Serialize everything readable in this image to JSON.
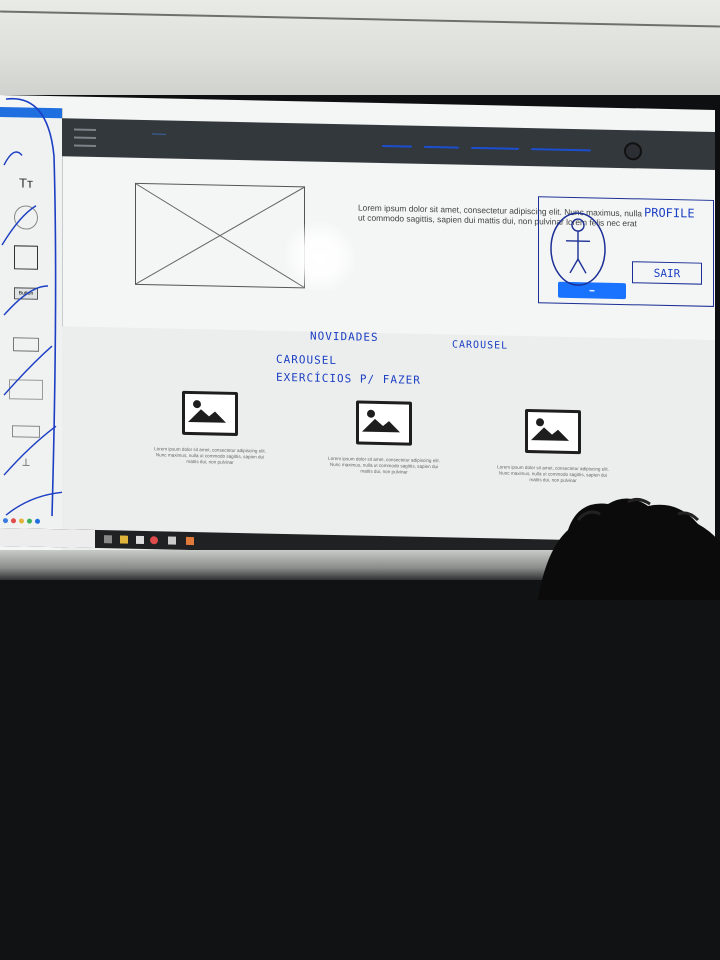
{
  "hero": {
    "paragraph": "Lorem ipsum dolor sit amet, consectetur adipiscing elit. Nunc maximus, nulla ut commodo sagittis, sapien dui mattis dui, non pulvinar lorem felis nec erat"
  },
  "annotations": {
    "novidades": "NOVIDADES",
    "carousel_right": "CAROUSEL",
    "carousel_left": "CAROUSEL",
    "exercicios": "EXERCÍCIOS P/ FAZER"
  },
  "profile": {
    "label": "PROFILE",
    "logout_label": "SAIR"
  },
  "cards": [
    {
      "text": "Lorem ipsum dolor sit amet, consectetur adipiscing elit. Nunc maximus, nulla ut commodo sagittis, sapien dui mattis dui, non pulvinar"
    },
    {
      "text": "Lorem ipsum dolor sit amet, consectetur adipiscing elit. Nunc maximus, nulla ut commodo sagittis, sapien dui mattis dui, non pulvinar"
    },
    {
      "text": "Lorem ipsum dolor sit amet, consectetur adipiscing elit. Nunc maximus, nulla ut commodo sagittis, sapien dui mattis dui, non pulvinar"
    }
  ],
  "palette": {
    "button_label": "Button"
  },
  "colors": {
    "accent": "#1a73ff",
    "header": "#33383d",
    "ink": "#1c3fc4"
  },
  "icons": [
    "hamburger-icon",
    "avatar-icon",
    "image-placeholder-icon",
    "stick-figure-icon"
  ]
}
